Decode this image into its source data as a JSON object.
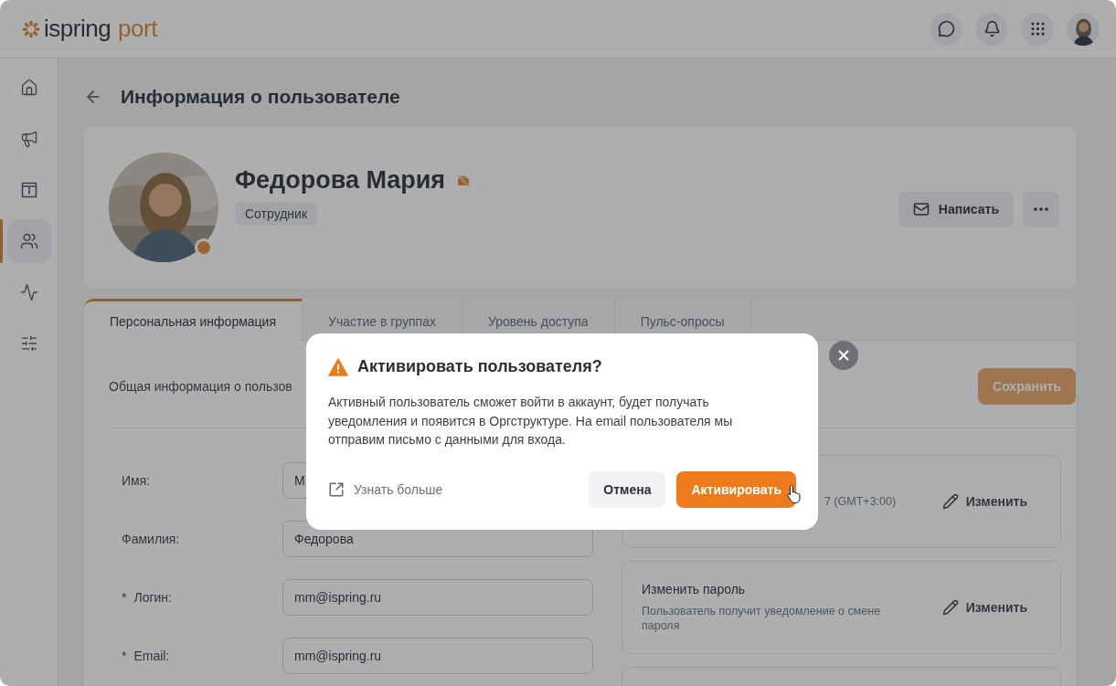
{
  "header": {
    "logo": {
      "brand": "ispring",
      "product": "port"
    }
  },
  "sidebar": {
    "items": [
      {
        "kind": "home",
        "selected": false
      },
      {
        "kind": "news",
        "selected": false
      },
      {
        "kind": "info",
        "selected": false
      },
      {
        "kind": "people",
        "selected": true
      },
      {
        "kind": "pulse",
        "selected": false
      },
      {
        "kind": "settings",
        "selected": false
      }
    ]
  },
  "page": {
    "title": "Информация о пользователе"
  },
  "profile": {
    "name": "Федорова Мария",
    "role": "Сотрудник",
    "message_button": "Написать"
  },
  "tabs": [
    {
      "label": "Персональная информация",
      "selected": true
    },
    {
      "label": "Участие в группах",
      "selected": false
    },
    {
      "label": "Уровень доступа",
      "selected": false
    },
    {
      "label": "Пульс-опросы",
      "selected": false
    }
  ],
  "section": {
    "title": "Общая информация о пользов",
    "save_button": "Сохранить"
  },
  "fields": [
    {
      "label": "Имя:",
      "required": false,
      "value": "М"
    },
    {
      "label": "Фамилия:",
      "required": false,
      "value": "Федорова"
    },
    {
      "label": "Логин:",
      "required": true,
      "required_mark": "*",
      "value": "mm@ispring.ru"
    },
    {
      "label": "Email:",
      "required": true,
      "required_mark": "*",
      "value": "mm@ispring.ru"
    }
  ],
  "cards": [
    {
      "description": "7 (GMT+3:00)",
      "action": "Изменить",
      "covered": true
    },
    {
      "title": "Изменить пароль",
      "description": "Пользователь получит уведомление о смене пароля",
      "action": "Изменить",
      "covered": false
    }
  ],
  "modal": {
    "title": "Активировать пользователя?",
    "text": "Активный пользователь сможет войти в аккаунт, будет получать уведомления и появится в Оргструктуре. На email пользователя мы отправим письмо с данными для входа.",
    "link": "Узнать больше",
    "buttons": [
      {
        "label": "Отмена",
        "kind": "secondary"
      },
      {
        "label": "Активировать",
        "kind": "primary"
      }
    ]
  }
}
